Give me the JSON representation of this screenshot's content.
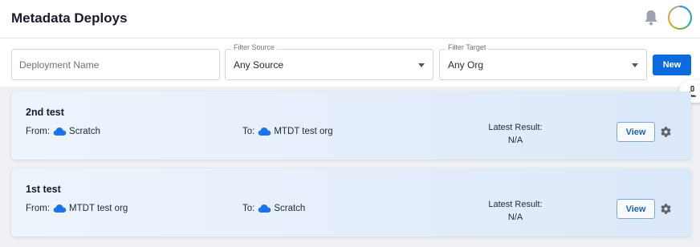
{
  "header": {
    "title": "Metadata Deploys",
    "icons": [
      "bell-icon",
      "avatar-icon"
    ]
  },
  "filters": {
    "deployment_name_placeholder": "Deployment Name",
    "source_label": "Filter Source",
    "source_value": "Any Source",
    "target_label": "Filter Target",
    "target_value": "Any Org",
    "new_label": "New"
  },
  "deploys": [
    {
      "name": "2nd test",
      "from_label": "From:",
      "from_org": "Scratch",
      "to_label": "To:",
      "to_org": "MTDT test org",
      "result_label": "Latest Result:",
      "result_value": "N/A",
      "view_label": "View"
    },
    {
      "name": "1st test",
      "from_label": "From:",
      "from_org": "MTDT test org",
      "to_label": "To:",
      "to_org": "Scratch",
      "result_label": "Latest Result:",
      "result_value": "N/A",
      "view_label": "View"
    }
  ],
  "colors": {
    "accent": "#0b6bde",
    "cloud": "#1a73e8",
    "card_bg": "#e3edfb"
  }
}
